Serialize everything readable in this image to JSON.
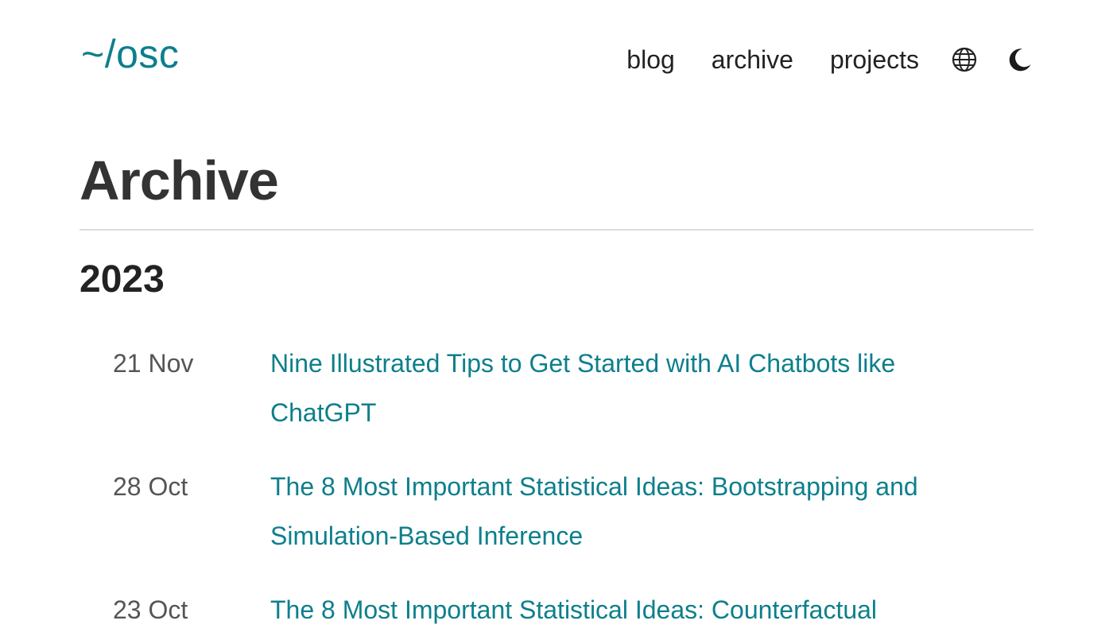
{
  "header": {
    "logo": "~/osc",
    "nav": [
      {
        "label": "blog"
      },
      {
        "label": "archive"
      },
      {
        "label": "projects"
      }
    ],
    "icons": [
      "globe-icon",
      "moon-icon"
    ]
  },
  "page": {
    "title": "Archive"
  },
  "archive": {
    "year": "2023",
    "posts": [
      {
        "date": "21 Nov",
        "title": "Nine Illustrated Tips to Get Started with AI Chatbots like ChatGPT"
      },
      {
        "date": "28 Oct",
        "title": "The 8 Most Important Statistical Ideas: Bootstrapping and Simulation-Based Inference"
      },
      {
        "date": "23 Oct",
        "title": "The 8 Most Important Statistical Ideas: Counterfactual"
      }
    ]
  },
  "colors": {
    "accent": "#0d7f8c",
    "text": "#222222",
    "muted": "#555555",
    "divider": "#dddddd"
  }
}
